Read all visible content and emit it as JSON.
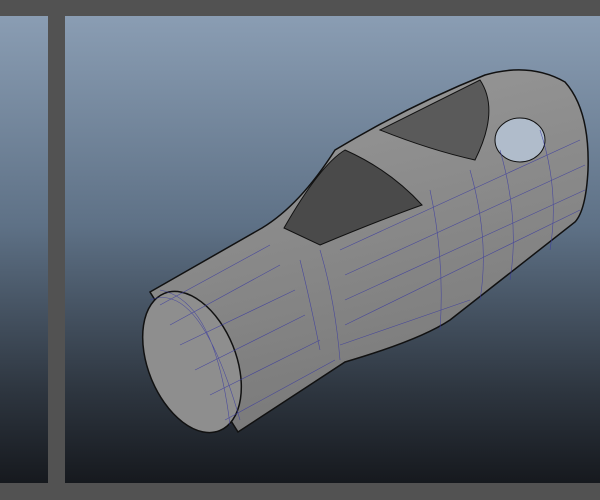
{
  "viewports": {
    "left_panel": "perspective",
    "main_panel": "perspective"
  },
  "colors": {
    "frame": "#525252",
    "bg_top": "#8a9db3",
    "bg_bottom": "#16191e",
    "mesh": "#8c8c8c",
    "wire": "#3a3aa0"
  }
}
